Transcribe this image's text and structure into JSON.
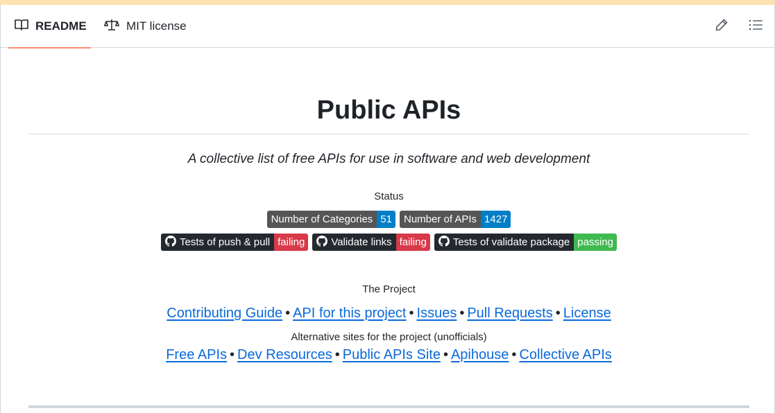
{
  "tabs": {
    "readme": "README",
    "license": "MIT license"
  },
  "header": {
    "edit_icon": "pencil-icon",
    "outline_icon": "list-icon"
  },
  "readme": {
    "title": "Public APIs",
    "subtitle": "A collective list of free APIs for use in software and web development",
    "status_label": "Status",
    "badges_row1": [
      {
        "label": "Number of Categories",
        "value": "51",
        "color": "#007ec6"
      },
      {
        "label": "Number of APIs",
        "value": "1427",
        "color": "#007ec6"
      }
    ],
    "badges_row2": [
      {
        "label": "Tests of push & pull",
        "value": "failing",
        "color": "#d73a49"
      },
      {
        "label": "Validate links",
        "value": "failing",
        "color": "#d73a49"
      },
      {
        "label": "Tests of validate package",
        "value": "passing",
        "color": "#3fb950"
      }
    ],
    "project_label": "The Project",
    "project_links": [
      "Contributing Guide",
      "API for this project",
      "Issues",
      "Pull Requests",
      "License"
    ],
    "alt_label": "Alternative sites for the project (unofficials)",
    "alt_links": [
      "Free APIs",
      "Dev Resources",
      "Public APIs Site",
      "Apihouse",
      "Collective APIs"
    ],
    "separator": "•"
  }
}
